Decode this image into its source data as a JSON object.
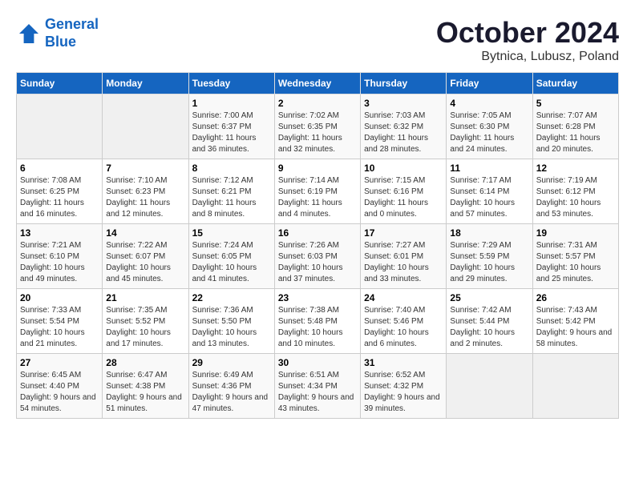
{
  "header": {
    "logo_line1": "General",
    "logo_line2": "Blue",
    "month": "October 2024",
    "location": "Bytnica, Lubusz, Poland"
  },
  "weekdays": [
    "Sunday",
    "Monday",
    "Tuesday",
    "Wednesday",
    "Thursday",
    "Friday",
    "Saturday"
  ],
  "weeks": [
    [
      {
        "day": "",
        "info": ""
      },
      {
        "day": "",
        "info": ""
      },
      {
        "day": "1",
        "info": "Sunrise: 7:00 AM\nSunset: 6:37 PM\nDaylight: 11 hours and 36 minutes."
      },
      {
        "day": "2",
        "info": "Sunrise: 7:02 AM\nSunset: 6:35 PM\nDaylight: 11 hours and 32 minutes."
      },
      {
        "day": "3",
        "info": "Sunrise: 7:03 AM\nSunset: 6:32 PM\nDaylight: 11 hours and 28 minutes."
      },
      {
        "day": "4",
        "info": "Sunrise: 7:05 AM\nSunset: 6:30 PM\nDaylight: 11 hours and 24 minutes."
      },
      {
        "day": "5",
        "info": "Sunrise: 7:07 AM\nSunset: 6:28 PM\nDaylight: 11 hours and 20 minutes."
      }
    ],
    [
      {
        "day": "6",
        "info": "Sunrise: 7:08 AM\nSunset: 6:25 PM\nDaylight: 11 hours and 16 minutes."
      },
      {
        "day": "7",
        "info": "Sunrise: 7:10 AM\nSunset: 6:23 PM\nDaylight: 11 hours and 12 minutes."
      },
      {
        "day": "8",
        "info": "Sunrise: 7:12 AM\nSunset: 6:21 PM\nDaylight: 11 hours and 8 minutes."
      },
      {
        "day": "9",
        "info": "Sunrise: 7:14 AM\nSunset: 6:19 PM\nDaylight: 11 hours and 4 minutes."
      },
      {
        "day": "10",
        "info": "Sunrise: 7:15 AM\nSunset: 6:16 PM\nDaylight: 11 hours and 0 minutes."
      },
      {
        "day": "11",
        "info": "Sunrise: 7:17 AM\nSunset: 6:14 PM\nDaylight: 10 hours and 57 minutes."
      },
      {
        "day": "12",
        "info": "Sunrise: 7:19 AM\nSunset: 6:12 PM\nDaylight: 10 hours and 53 minutes."
      }
    ],
    [
      {
        "day": "13",
        "info": "Sunrise: 7:21 AM\nSunset: 6:10 PM\nDaylight: 10 hours and 49 minutes."
      },
      {
        "day": "14",
        "info": "Sunrise: 7:22 AM\nSunset: 6:07 PM\nDaylight: 10 hours and 45 minutes."
      },
      {
        "day": "15",
        "info": "Sunrise: 7:24 AM\nSunset: 6:05 PM\nDaylight: 10 hours and 41 minutes."
      },
      {
        "day": "16",
        "info": "Sunrise: 7:26 AM\nSunset: 6:03 PM\nDaylight: 10 hours and 37 minutes."
      },
      {
        "day": "17",
        "info": "Sunrise: 7:27 AM\nSunset: 6:01 PM\nDaylight: 10 hours and 33 minutes."
      },
      {
        "day": "18",
        "info": "Sunrise: 7:29 AM\nSunset: 5:59 PM\nDaylight: 10 hours and 29 minutes."
      },
      {
        "day": "19",
        "info": "Sunrise: 7:31 AM\nSunset: 5:57 PM\nDaylight: 10 hours and 25 minutes."
      }
    ],
    [
      {
        "day": "20",
        "info": "Sunrise: 7:33 AM\nSunset: 5:54 PM\nDaylight: 10 hours and 21 minutes."
      },
      {
        "day": "21",
        "info": "Sunrise: 7:35 AM\nSunset: 5:52 PM\nDaylight: 10 hours and 17 minutes."
      },
      {
        "day": "22",
        "info": "Sunrise: 7:36 AM\nSunset: 5:50 PM\nDaylight: 10 hours and 13 minutes."
      },
      {
        "day": "23",
        "info": "Sunrise: 7:38 AM\nSunset: 5:48 PM\nDaylight: 10 hours and 10 minutes."
      },
      {
        "day": "24",
        "info": "Sunrise: 7:40 AM\nSunset: 5:46 PM\nDaylight: 10 hours and 6 minutes."
      },
      {
        "day": "25",
        "info": "Sunrise: 7:42 AM\nSunset: 5:44 PM\nDaylight: 10 hours and 2 minutes."
      },
      {
        "day": "26",
        "info": "Sunrise: 7:43 AM\nSunset: 5:42 PM\nDaylight: 9 hours and 58 minutes."
      }
    ],
    [
      {
        "day": "27",
        "info": "Sunrise: 6:45 AM\nSunset: 4:40 PM\nDaylight: 9 hours and 54 minutes."
      },
      {
        "day": "28",
        "info": "Sunrise: 6:47 AM\nSunset: 4:38 PM\nDaylight: 9 hours and 51 minutes."
      },
      {
        "day": "29",
        "info": "Sunrise: 6:49 AM\nSunset: 4:36 PM\nDaylight: 9 hours and 47 minutes."
      },
      {
        "day": "30",
        "info": "Sunrise: 6:51 AM\nSunset: 4:34 PM\nDaylight: 9 hours and 43 minutes."
      },
      {
        "day": "31",
        "info": "Sunrise: 6:52 AM\nSunset: 4:32 PM\nDaylight: 9 hours and 39 minutes."
      },
      {
        "day": "",
        "info": ""
      },
      {
        "day": "",
        "info": ""
      }
    ]
  ]
}
